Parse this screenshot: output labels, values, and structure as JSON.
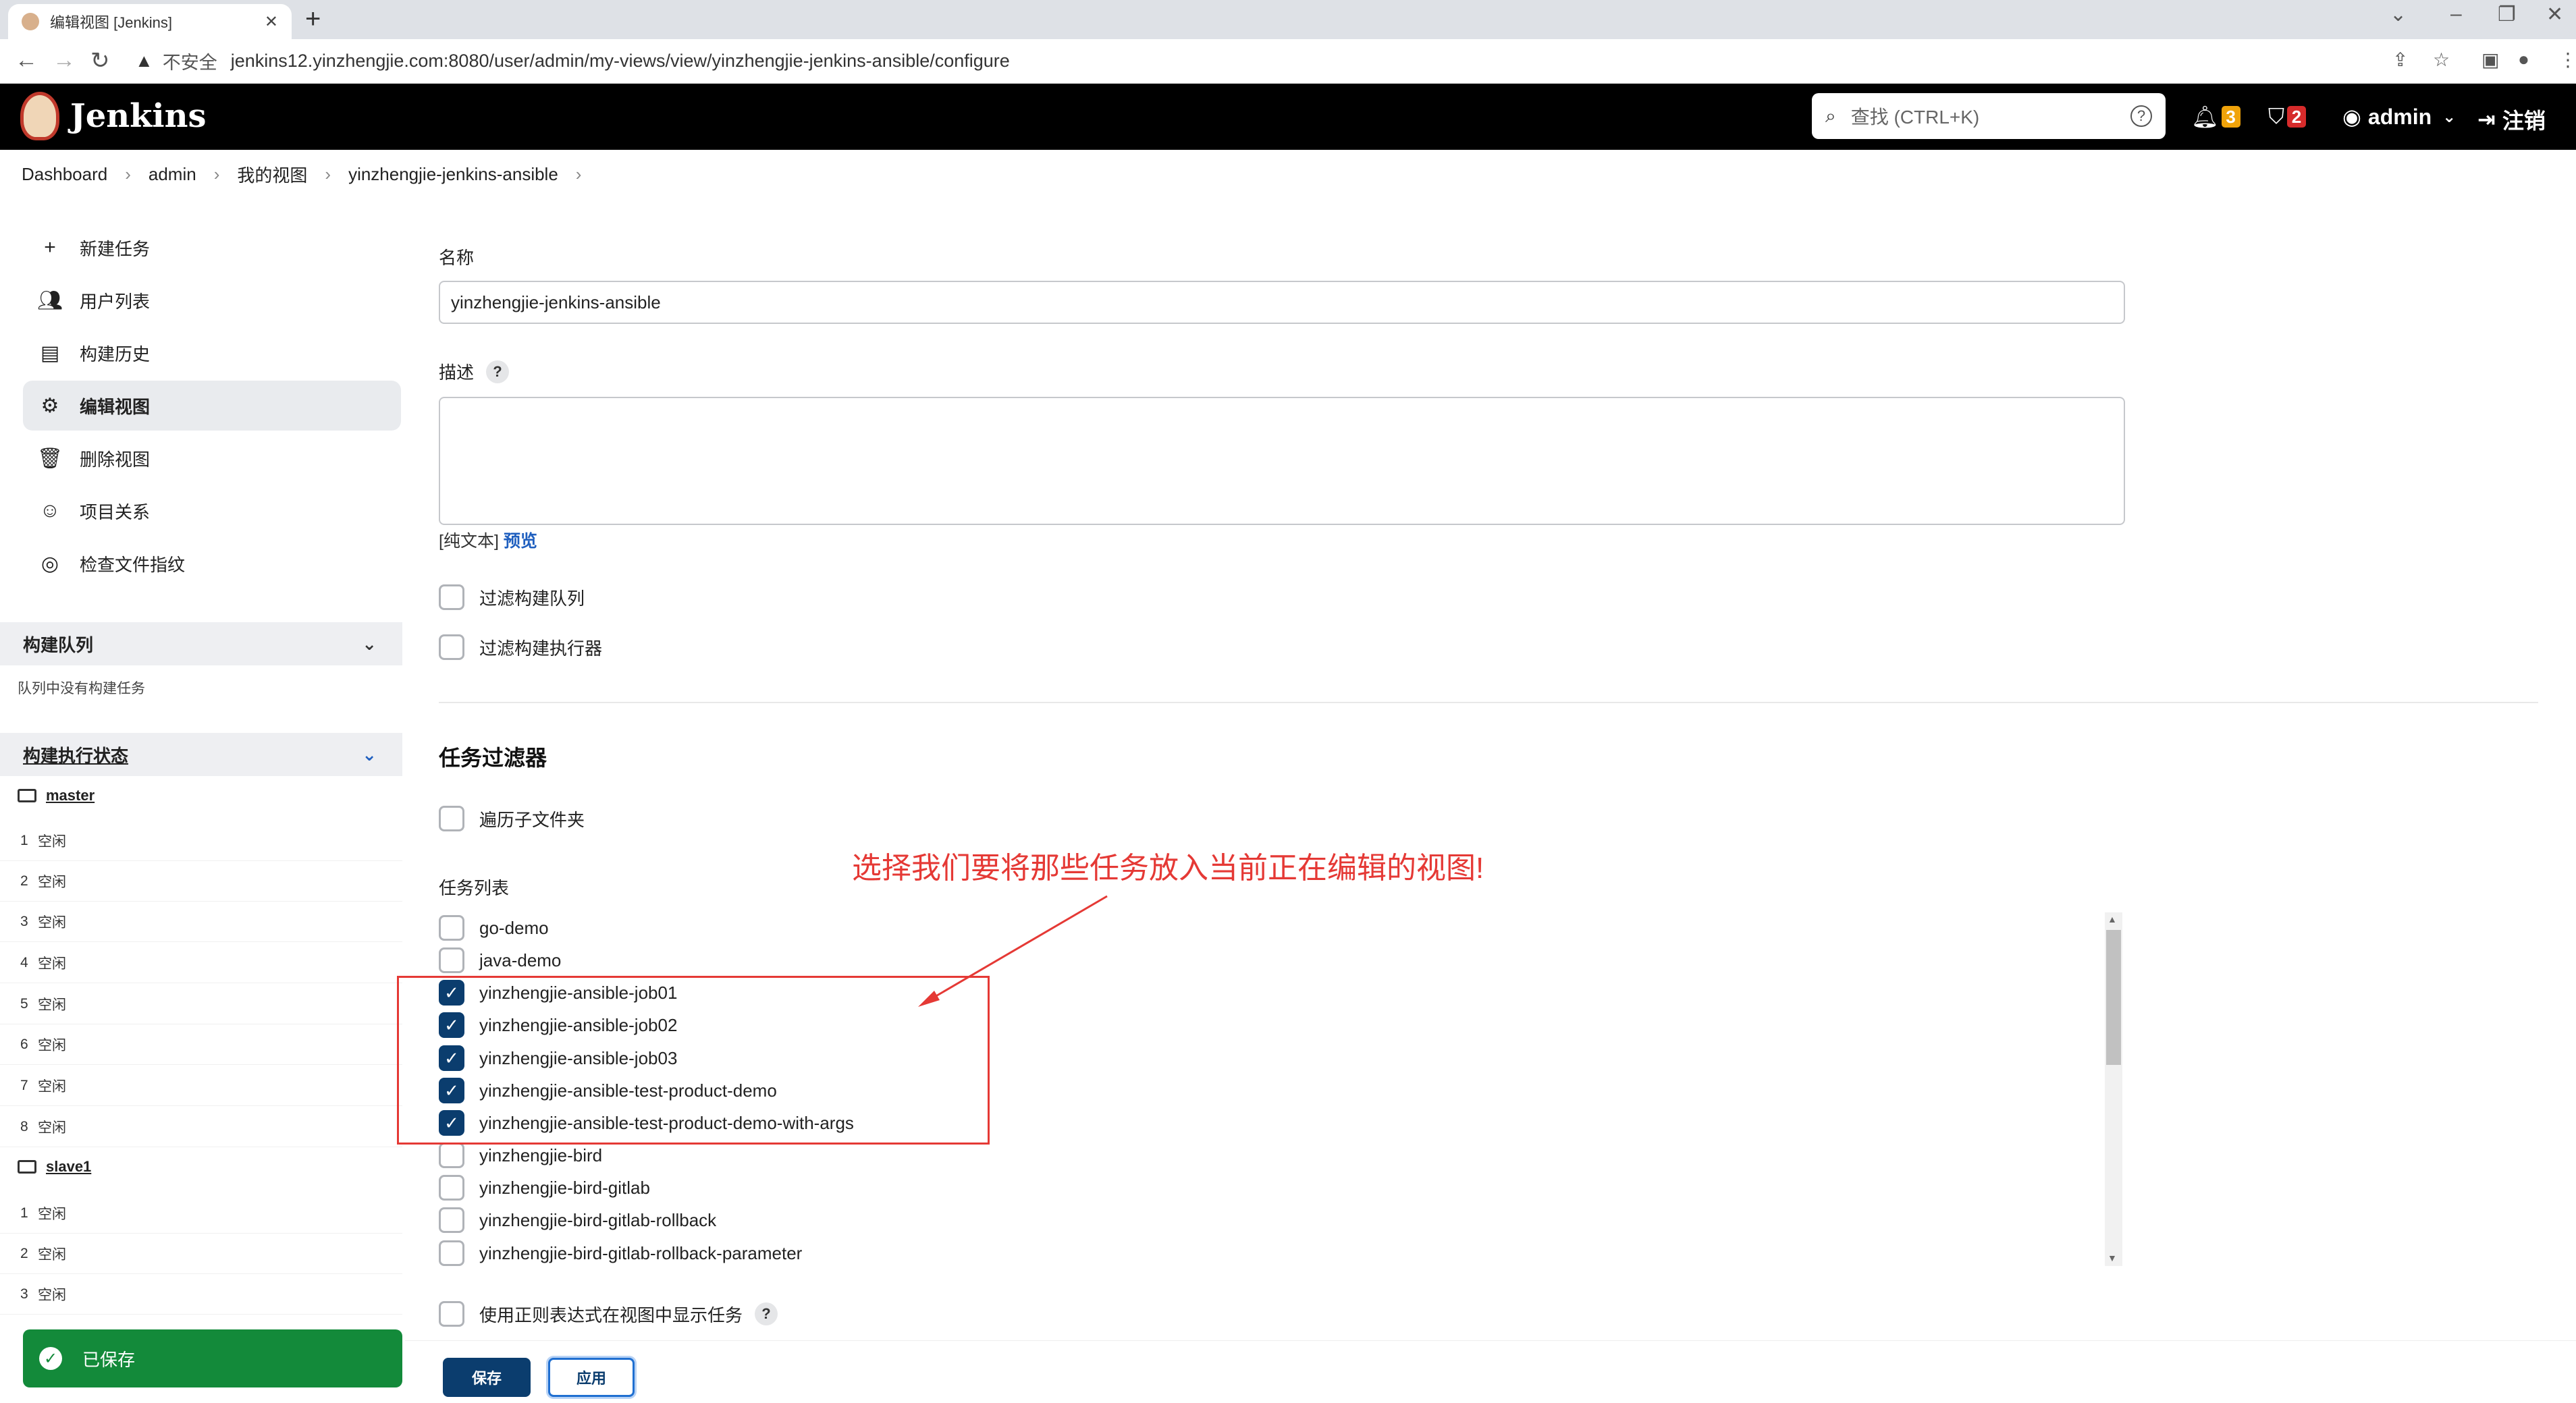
{
  "browser": {
    "tab_title": "编辑视图 [Jenkins]",
    "new_tab": "+",
    "insecure_label": "不安全",
    "url": "jenkins12.yinzhengjie.com:8080/user/admin/my-views/view/yinzhengjie-jenkins-ansible/configure"
  },
  "header": {
    "brand": "Jenkins",
    "search_placeholder": "查找 (CTRL+K)",
    "notifications_count": "3",
    "security_count": "2",
    "user": "admin",
    "logout": "注销",
    "notify_color": "#f0a30a",
    "security_color": "#d62b2b"
  },
  "breadcrumb": [
    "Dashboard",
    "admin",
    "我的视图",
    "yinzhengjie-jenkins-ansible"
  ],
  "sidebar": {
    "items": [
      {
        "label": "新建任务",
        "icon": "plus-icon"
      },
      {
        "label": "用户列表",
        "icon": "users-icon"
      },
      {
        "label": "构建历史",
        "icon": "history-icon"
      },
      {
        "label": "编辑视图",
        "icon": "gear-icon"
      },
      {
        "label": "删除视图",
        "icon": "trash-icon"
      },
      {
        "label": "项目关系",
        "icon": "relations-icon"
      },
      {
        "label": "检查文件指纹",
        "icon": "fingerprint-icon"
      }
    ],
    "queue_title": "构建队列",
    "queue_empty": "队列中没有构建任务",
    "executors_title": "构建执行状态",
    "nodes": [
      {
        "name": "master",
        "executors": [
          {
            "num": "1",
            "status": "空闲"
          },
          {
            "num": "2",
            "status": "空闲"
          },
          {
            "num": "3",
            "status": "空闲"
          },
          {
            "num": "4",
            "status": "空闲"
          },
          {
            "num": "5",
            "status": "空闲"
          },
          {
            "num": "6",
            "status": "空闲"
          },
          {
            "num": "7",
            "status": "空闲"
          },
          {
            "num": "8",
            "status": "空闲"
          }
        ]
      },
      {
        "name": "slave1",
        "executors": [
          {
            "num": "1",
            "status": "空闲"
          },
          {
            "num": "2",
            "status": "空闲"
          },
          {
            "num": "3",
            "status": "空闲"
          }
        ]
      }
    ],
    "toast": "已保存"
  },
  "form": {
    "name_label": "名称",
    "name_value": "yinzhengjie-jenkins-ansible",
    "desc_label": "描述",
    "help_q": "?",
    "plain_text": "[纯文本]",
    "preview": "预览",
    "filter_queue": "过滤构建队列",
    "filter_executors": "过滤构建执行器",
    "job_filter_title": "任务过滤器",
    "recurse_label": "遍历子文件夹",
    "job_list_label": "任务列表",
    "jobs": [
      {
        "name": "go-demo",
        "checked": false
      },
      {
        "name": "java-demo",
        "checked": false
      },
      {
        "name": "yinzhengjie-ansible-job01",
        "checked": true
      },
      {
        "name": "yinzhengjie-ansible-job02",
        "checked": true
      },
      {
        "name": "yinzhengjie-ansible-job03",
        "checked": true
      },
      {
        "name": "yinzhengjie-ansible-test-product-demo",
        "checked": true
      },
      {
        "name": "yinzhengjie-ansible-test-product-demo-with-args",
        "checked": true
      },
      {
        "name": "yinzhengjie-bird",
        "checked": false
      },
      {
        "name": "yinzhengjie-bird-gitlab",
        "checked": false
      },
      {
        "name": "yinzhengjie-bird-gitlab-rollback",
        "checked": false
      },
      {
        "name": "yinzhengjie-bird-gitlab-rollback-parameter",
        "checked": false
      }
    ],
    "regex_label": "使用正则表达式在视图中显示任务",
    "save_button": "保存",
    "apply_button": "应用"
  },
  "annotation": {
    "text": "选择我们要将那些任务放入当前正在编辑的视图!",
    "color": "#e53935"
  }
}
